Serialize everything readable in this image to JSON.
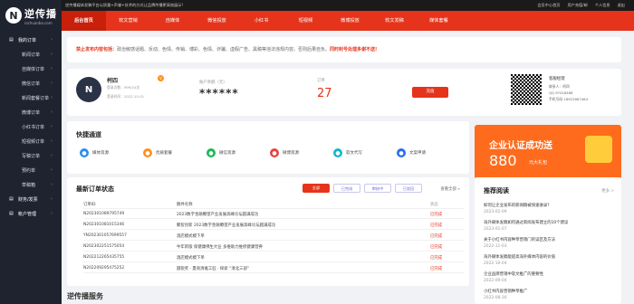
{
  "brand": {
    "name": "逆传播",
    "url": "nichuanbo.com"
  },
  "topbar": {
    "notice": "逆传播媒体发稿平台以质量+声誉+技术的方式让品牌传播更高效展示!",
    "links": [
      "会员中心首页",
      "用户充值/邮",
      "个人信息",
      "退出"
    ]
  },
  "sidebar": {
    "items": [
      {
        "label": "我的订单",
        "level": "top"
      },
      {
        "label": "新闻订单",
        "level": "sub"
      },
      {
        "label": "自媒体订单",
        "level": "sub"
      },
      {
        "label": "微信订单",
        "level": "sub"
      },
      {
        "label": "新闻套餐订单",
        "level": "sub"
      },
      {
        "label": "微博订单",
        "level": "sub"
      },
      {
        "label": "小红书订单",
        "level": "sub"
      },
      {
        "label": "短视频订单",
        "level": "sub"
      },
      {
        "label": "写稿订单",
        "level": "sub"
      },
      {
        "label": "预约单",
        "level": "sub"
      },
      {
        "label": "草稿箱",
        "level": "sub"
      },
      {
        "label": "财务/发票",
        "level": "top"
      },
      {
        "label": "帐户管理",
        "level": "top"
      }
    ]
  },
  "tabs": [
    "后台首页",
    "软文营销",
    "自媒体",
    "微信投放",
    "小红书",
    "短视频",
    "微博投放",
    "软文发稿",
    "媒体套餐"
  ],
  "notice": {
    "label": "禁止发布内容包括：",
    "text": "政治敏感话题、反动、色情、传销、博彩、色情、诈骗、虚假广告、黑稿等违法违规内容。否则后果自负。",
    "warn": "同时封号处理多谢不送!"
  },
  "account": {
    "user": "柯四",
    "stat1": "登录次数：999/24次",
    "stat2": "登录时间：2022-10-01",
    "balance_label": "账户余额（元）",
    "balance": "******",
    "grade_label": "订单",
    "grade": "27",
    "recharge": "充值",
    "service_title": "客服经理",
    "service_name": "联系人：柯四",
    "qq_label": "QQ",
    "qq": "97418468",
    "tel_label": "手机号码",
    "tel": "18922667464"
  },
  "quick": {
    "title": "快捷通道",
    "items": [
      {
        "label": "媒体资源",
        "color": "#2a8df2",
        "icon": "media-icon"
      },
      {
        "label": "优质套餐",
        "color": "#ff8f1f",
        "icon": "package-icon"
      },
      {
        "label": "微信资源",
        "color": "#19b955",
        "icon": "wechat-icon"
      },
      {
        "label": "微博资源",
        "color": "#e64340",
        "icon": "weibo-icon"
      },
      {
        "label": "软文代写",
        "color": "#17b6c8",
        "icon": "write-icon"
      },
      {
        "label": "文案申请",
        "color": "#2a6cf2",
        "icon": "apply-icon"
      }
    ]
  },
  "orders": {
    "title": "最新订单状态",
    "filters": [
      "全部",
      "已完成",
      "审核中",
      "已驳回"
    ],
    "more": "查看全部 »",
    "head": [
      "订单ID",
      "稿件名称",
      "状态"
    ],
    "rows": [
      {
        "id": "N202301089795749",
        "name": "2023数字金融瞭望产业发展高峰论坛圆满成功",
        "status": "已完成"
      },
      {
        "id": "N202301081015346",
        "name": "聚智创新 2023数字金融瞭望产业发展高峰论坛圆满成功",
        "status": "已完成"
      },
      {
        "id": "YN202301057699557",
        "name": "酒店模式模下单",
        "status": "已完成"
      },
      {
        "id": "N202302251575054",
        "name": "牛年新版 保健康佛生大业 多维助力维修健康营养",
        "status": "已完成"
      },
      {
        "id": "N202212265435755",
        "name": "酒店模式模下单",
        "status": "已完成"
      },
      {
        "id": "N202209295475252",
        "name": "圆锐奖 · 夏商清雅工匠 · 探索 “清北三部”",
        "status": "已完成"
      }
    ]
  },
  "promo": {
    "title": "企业认证成功送",
    "amount": "880",
    "unit": "元大礼包"
  },
  "reads": {
    "title": "推荐阅读",
    "more": "更多 >",
    "items": [
      {
        "t": "如何让企业发布的新闻稿被快速收录?",
        "d": "2023-02-09"
      },
      {
        "t": "海外媒体发稿如何通过新闻发布建立的10个建议",
        "d": "2023-01-07"
      },
      {
        "t": "关于小红书内容种草营销门的误区及方法",
        "d": "2022-11-03"
      },
      {
        "t": "海外媒体发稿能提高海外媒体内容的价值",
        "d": "2022-10-04"
      },
      {
        "t": "企业品牌营销中软文推广的重要性",
        "d": "2022-09-04"
      },
      {
        "t": "小红书内容营销种草推广",
        "d": "2022-08-30"
      }
    ]
  },
  "footer_title": "逆传播服务"
}
